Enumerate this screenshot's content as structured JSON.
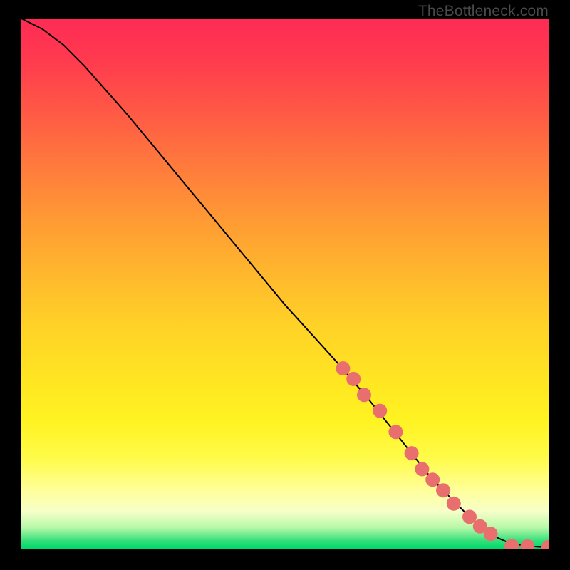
{
  "watermark": "TheBottleneck.com",
  "chart_data": {
    "type": "line",
    "title": "",
    "xlabel": "",
    "ylabel": "",
    "xlim": [
      0,
      100
    ],
    "ylim": [
      0,
      100
    ],
    "grid": false,
    "curve": {
      "name": "bottleneck-curve",
      "x": [
        0,
        4,
        8,
        12,
        20,
        30,
        40,
        50,
        60,
        66,
        70,
        74,
        78,
        82,
        85,
        88,
        90,
        92,
        94,
        96,
        98,
        100
      ],
      "y": [
        100,
        98,
        95,
        91,
        82,
        70,
        58,
        46,
        35,
        28,
        23,
        18,
        13,
        9,
        6,
        3.5,
        2.2,
        1.3,
        0.8,
        0.5,
        0.35,
        0.3
      ]
    },
    "markers": {
      "name": "curve-markers",
      "color": "#e96f6f",
      "radius_px": 10,
      "x": [
        61,
        63,
        65,
        68,
        71,
        74,
        76,
        78,
        80,
        82,
        85,
        87,
        89,
        93,
        96,
        100
      ],
      "y": [
        34,
        32,
        29,
        26,
        22,
        18,
        15,
        13,
        11,
        8.5,
        6,
        4.2,
        2.8,
        0.5,
        0.4,
        0.3
      ]
    }
  }
}
